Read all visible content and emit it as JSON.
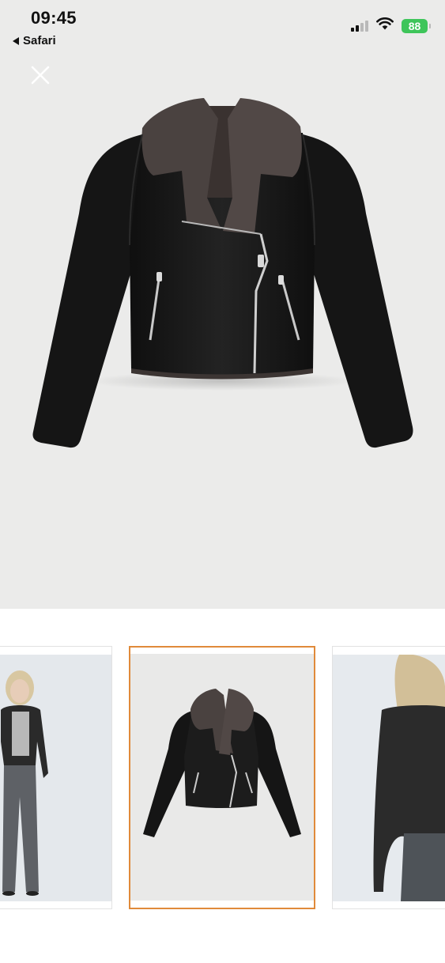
{
  "status_bar": {
    "time": "09:45",
    "back_app_label": "Safari",
    "battery_level": "88",
    "signal_bars_active": 2,
    "signal_bars_total": 4,
    "icons": [
      "signal-icon",
      "wifi-icon",
      "battery-icon"
    ]
  },
  "viewer": {
    "close_icon": "close-icon",
    "main_image": "black-leather-biker-jacket-with-brown-shearling-collar"
  },
  "thumbnails": {
    "selected_index": 1,
    "items": [
      {
        "image": "model-front-wearing-jacket",
        "selected": false
      },
      {
        "image": "jacket-product-shot",
        "selected": true
      },
      {
        "image": "model-back-wearing-jacket",
        "selected": false
      }
    ]
  },
  "colors": {
    "viewer_background": "#ebebea",
    "selected_border": "#e08a3a",
    "battery_green": "#3ec55a",
    "jacket_black": "#161616",
    "shearling_brown": "#4a4240"
  }
}
